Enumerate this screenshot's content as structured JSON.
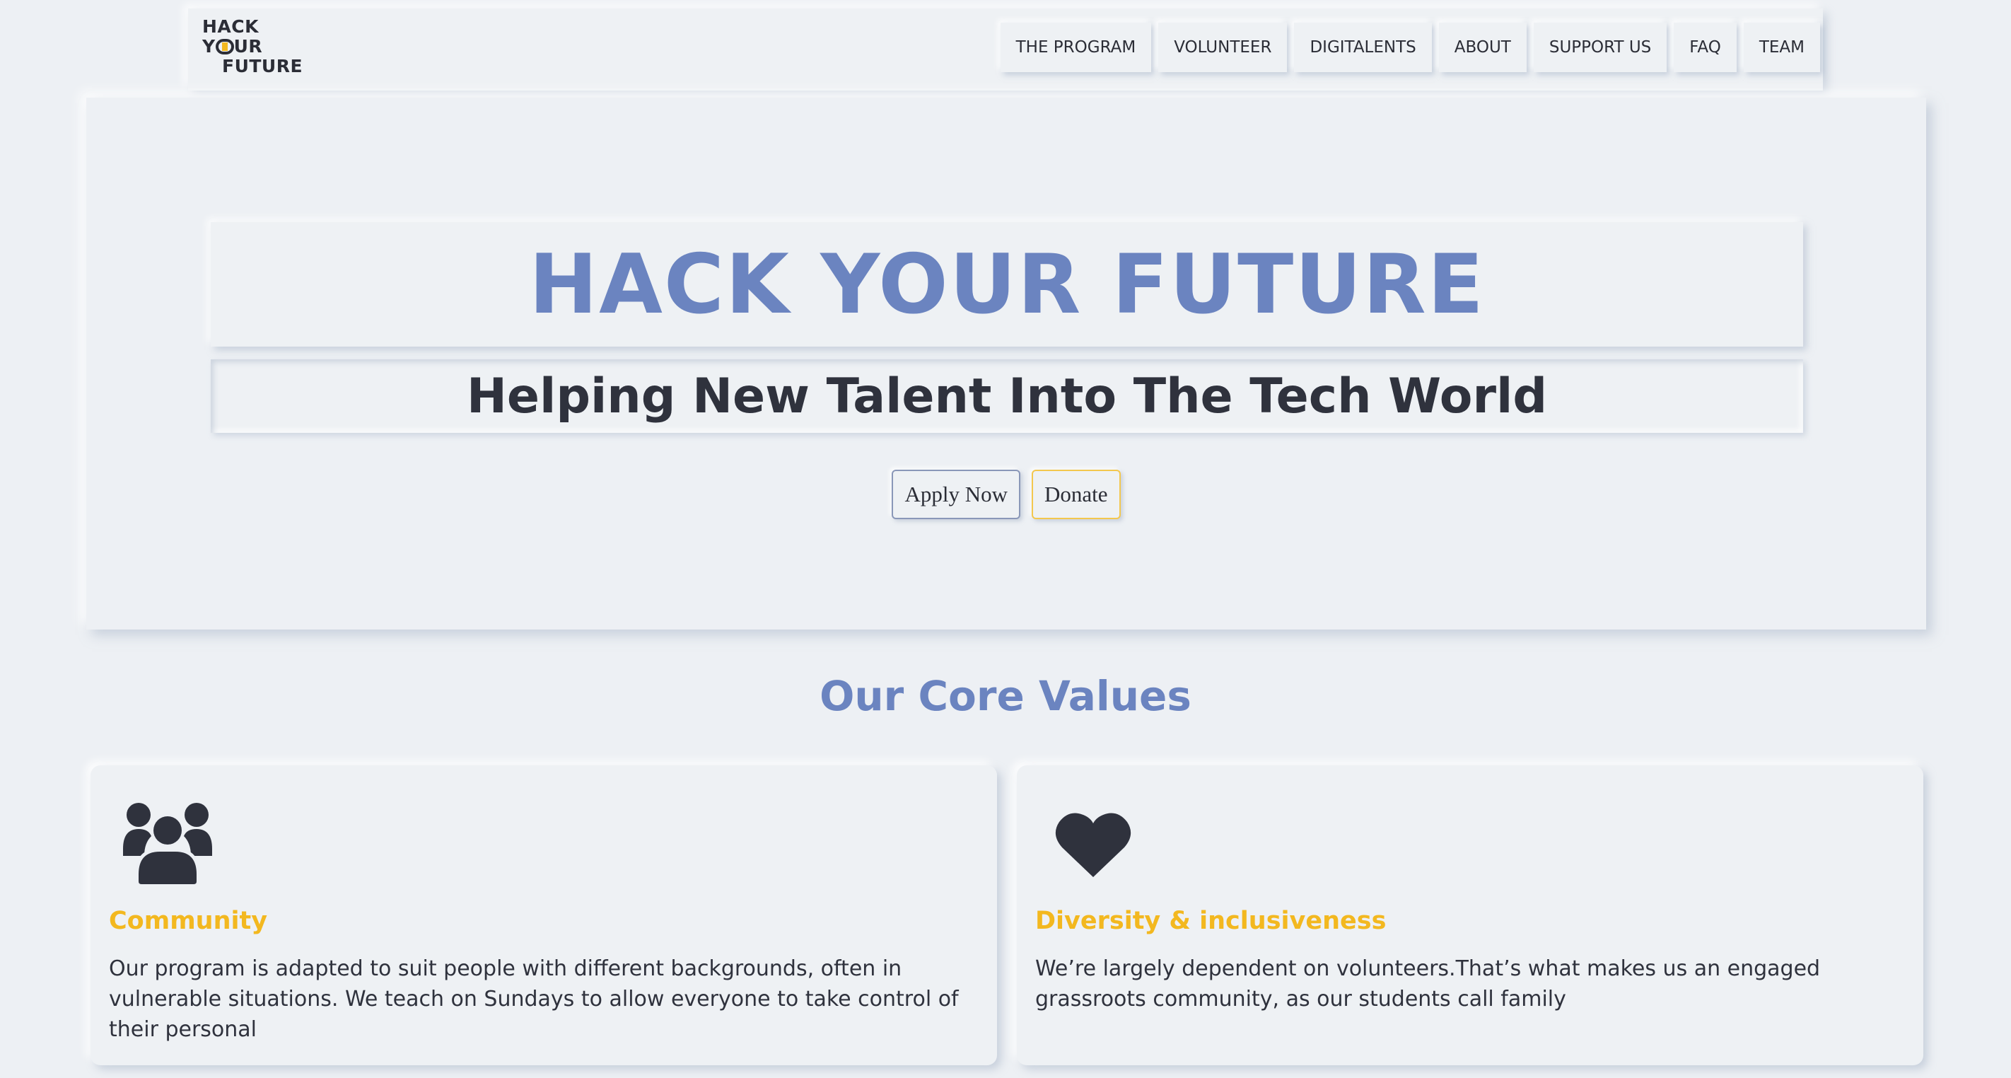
{
  "header": {
    "logo": {
      "line1": "HACK",
      "line2_prefix": "Y",
      "line2_suffix": "UR",
      "line3": "FUTURE"
    },
    "nav": [
      "THE PROGRAM",
      "VOLUNTEER",
      "DIGITALENTS",
      "ABOUT",
      "SUPPORT US",
      "FAQ",
      "TEAM"
    ]
  },
  "hero": {
    "title": "HACK YOUR FUTURE",
    "subtitle": "Helping New Talent Into The Tech World",
    "apply_label": "Apply Now",
    "donate_label": "Donate"
  },
  "core_values": {
    "title": "Our Core Values",
    "cards": [
      {
        "icon": "users-icon",
        "title": "Community",
        "text": "Our program is adapted to suit people with different backgrounds, often in vulnerable situations. We teach on Sundays to allow everyone to take control of their personal"
      },
      {
        "icon": "heart-icon",
        "title": "Diversity & inclusiveness",
        "text": "We’re largely dependent on volunteers.That’s what makes us an engaged grassroots community, as our students call family"
      }
    ]
  },
  "colors": {
    "background": "#edf0f4",
    "accent_blue": "#6b84c0",
    "accent_yellow": "#f3b81f",
    "text_dark": "#2f323d"
  }
}
